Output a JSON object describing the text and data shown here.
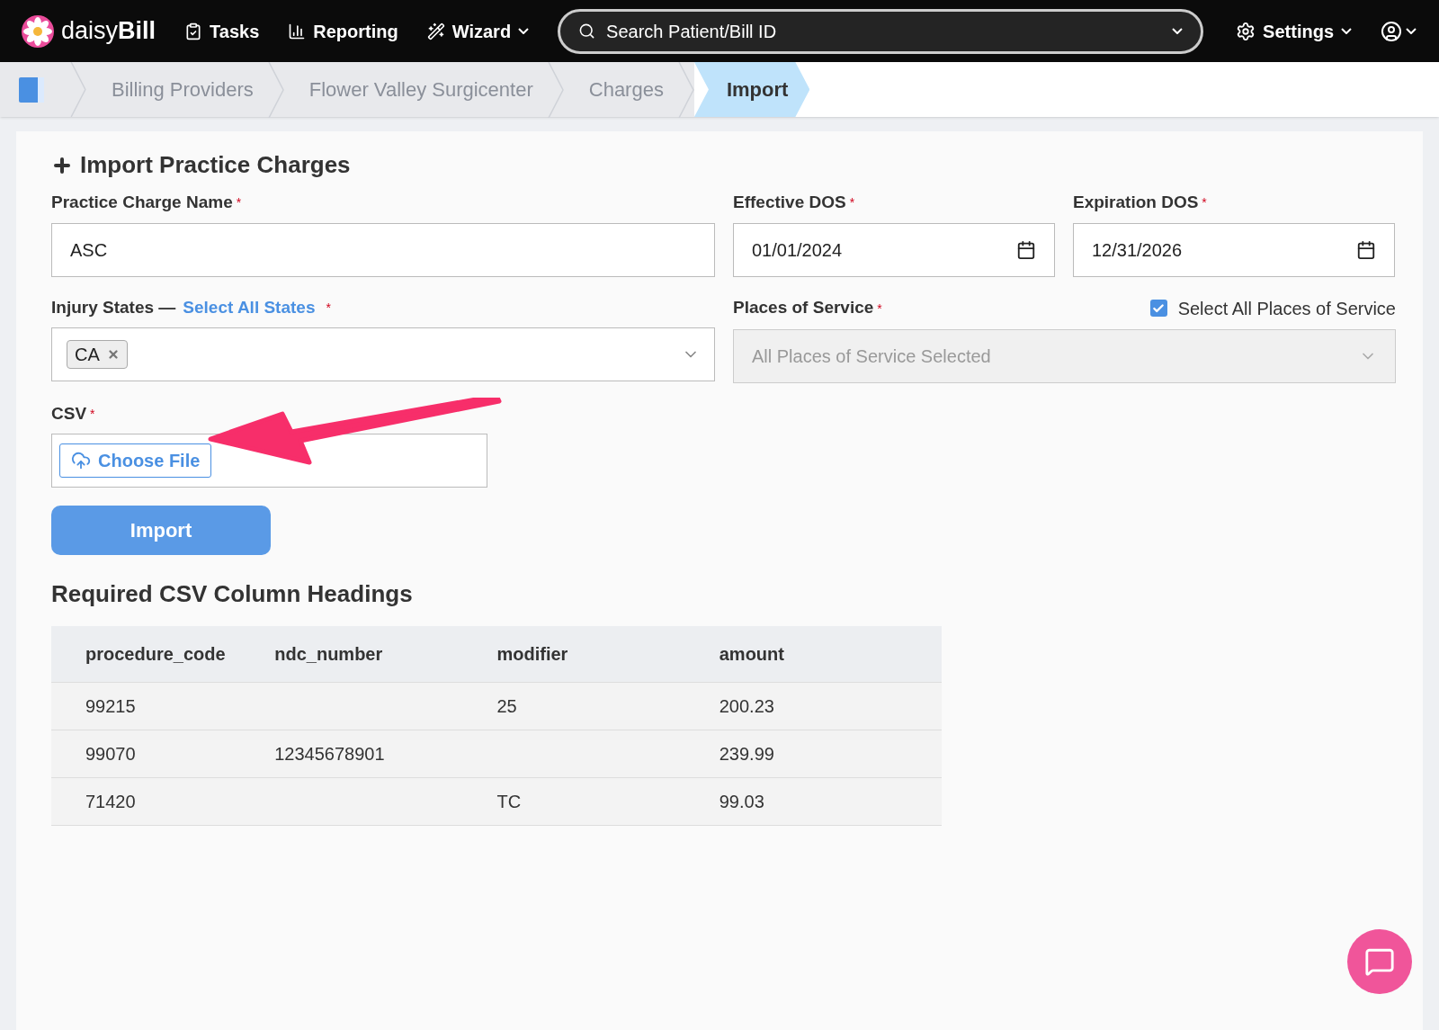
{
  "nav": {
    "logo": "daisy**Bill**",
    "items": [
      {
        "label": "Tasks",
        "kind": "tasks"
      },
      {
        "label": "Reporting",
        "kind": "reporting"
      },
      {
        "label": "Wizard",
        "kind": "wizard"
      }
    ],
    "search": {
      "placeholder": "Search Patient/Bill ID"
    },
    "settings": "Settings"
  },
  "required_mark": "*",
  "breadcrumbs": [
    {
      "label": "Billing Providers",
      "selected": false
    },
    {
      "label": "Flower Valley Surgicenter",
      "selected": false
    },
    {
      "label": "Charges",
      "selected": false
    },
    {
      "label": "Import",
      "selected": true
    }
  ],
  "form": {
    "title": "Import Practice Charges",
    "name": {
      "label": "Practice Charge Name",
      "value": "ASC"
    },
    "effective": {
      "label": "Effective DOS",
      "value": "01/01/2024"
    },
    "expiration": {
      "label": "Expiration DOS",
      "value": "12/31/2026"
    },
    "states": {
      "label": "Injury States —",
      "link": "Select All States",
      "tags": [
        "CA"
      ]
    },
    "places": {
      "label": "Places of Service",
      "checkbox": "Select All Places of Service",
      "checked": true,
      "value": "All Places of Service Selected"
    },
    "csv": {
      "label": "CSV",
      "button": "Choose File"
    },
    "submit": "Import"
  },
  "table": {
    "title": "Required CSV Column Headings",
    "columns": [
      "procedure_code",
      "ndc_number",
      "modifier",
      "amount"
    ],
    "rows": [
      [
        "99215",
        "",
        "25",
        "200.23"
      ],
      [
        "99070",
        "12345678901",
        "",
        "239.99"
      ],
      [
        "71420",
        "",
        "TC",
        "99.03"
      ]
    ]
  }
}
